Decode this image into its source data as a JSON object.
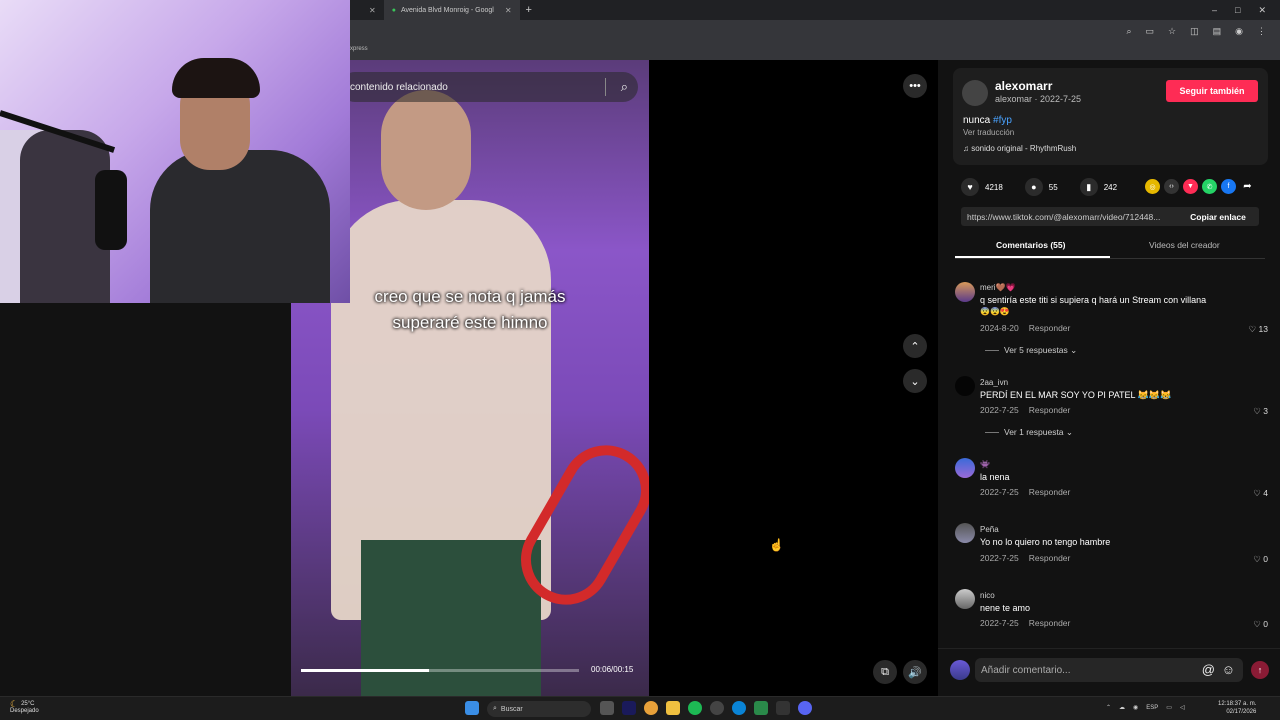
{
  "browser": {
    "tabs": [
      {
        "label": ""
      },
      {
        "label": "Avenida Blvd Monroig - Googl"
      }
    ],
    "bookmark_text": "xpress"
  },
  "video": {
    "search_placeholder": "contenido relacionado",
    "caption_line1": "creo que se nota q jamás",
    "caption_line2": "superaré este himno",
    "time": "00:06/00:15",
    "progress": 0.46
  },
  "author": {
    "name": "alexomarr",
    "subline": "alexomar · 2022-7-25",
    "follow_label": "Seguir también",
    "desc_text": "nunca ",
    "desc_tag": "#fyp",
    "translate_label": "Ver traducción",
    "sound": "sonido original - RhythmRush"
  },
  "stats": {
    "likes": "4218",
    "comments": "55",
    "saves": "242"
  },
  "link": {
    "url": "https://www.tiktok.com/@alexomarr/video/712448...",
    "copy_label": "Copiar enlace"
  },
  "panel_tabs": {
    "comments": "Comentarios (55)",
    "creator": "Videos del creador"
  },
  "comments": [
    {
      "user": "meri🤎💗",
      "text": "q sentiría este titi si supiera q hará un Stream con villana",
      "emoji_line": "😨😨😍",
      "date": "2024-8-20",
      "reply": "Responder",
      "likes": "13",
      "replies": "Ver 5 respuestas"
    },
    {
      "user": "2aa_ivn",
      "text": "PERDÍ EN EL MAR SOY YO PI PATEL 😹😹😹",
      "date": "2022-7-25",
      "reply": "Responder",
      "likes": "3",
      "replies": "Ver 1 respuesta"
    },
    {
      "user": "👾",
      "text": "la nena",
      "date": "2022-7-25",
      "reply": "Responder",
      "likes": "4"
    },
    {
      "user": "Peña",
      "text": "Yo no lo quiero no tengo hambre",
      "date": "2022-7-25",
      "reply": "Responder",
      "likes": "0"
    },
    {
      "user": "nico",
      "text": "nene te amo",
      "date": "2022-7-25",
      "reply": "Responder",
      "likes": "0"
    }
  ],
  "comment_input": {
    "placeholder": "Añadir comentario..."
  },
  "taskbar": {
    "temp": "25°C",
    "weather": "Despejado",
    "search_label": "Buscar",
    "lang": "ESP",
    "time": "12:18:37 a. m.",
    "date": "02/17/2026"
  },
  "colors": {
    "accent": "#fe2c55",
    "link": "#4aa3ff"
  }
}
